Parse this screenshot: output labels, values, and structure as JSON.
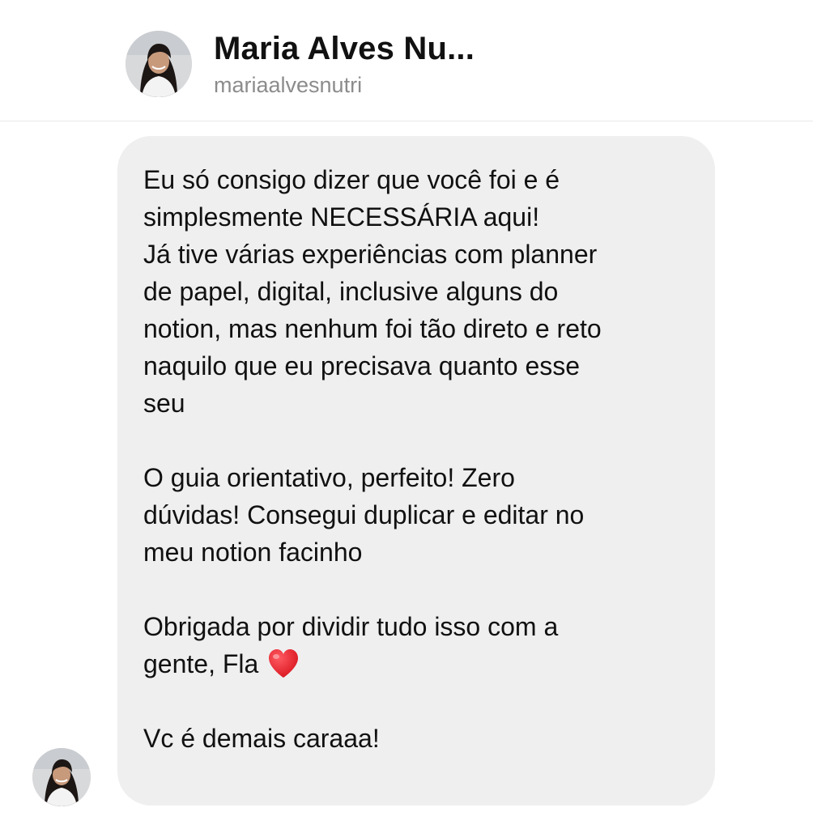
{
  "header": {
    "name": "Maria Alves Nu...",
    "username": "mariaalvesnutri",
    "avatar_icon": "profile-photo-avatar"
  },
  "message": {
    "paragraph_1": "Eu só consigo dizer que você foi e é\nsimplesmente NECESSÁRIA aqui!",
    "paragraph_2": "Já tive várias experiências com planner\nde papel, digital, inclusive alguns do\nnotion, mas nenhum foi tão direto e reto\nnaquilo que eu precisava quanto esse\nseu",
    "paragraph_3": "O guia orientativo, perfeito! Zero\ndúvidas! Consegui duplicar e editar no\nmeu notion facinho",
    "paragraph_4": "Obrigada por dividir tudo isso com a\ngente, Fla",
    "paragraph_4_icon": "red-heart-emoji",
    "paragraph_5": "Vc é demais caraaa!"
  },
  "colors": {
    "bubble_background": "#efeff0",
    "text": "#111111",
    "username": "#8c8c8c",
    "heart": "#e0202e"
  }
}
